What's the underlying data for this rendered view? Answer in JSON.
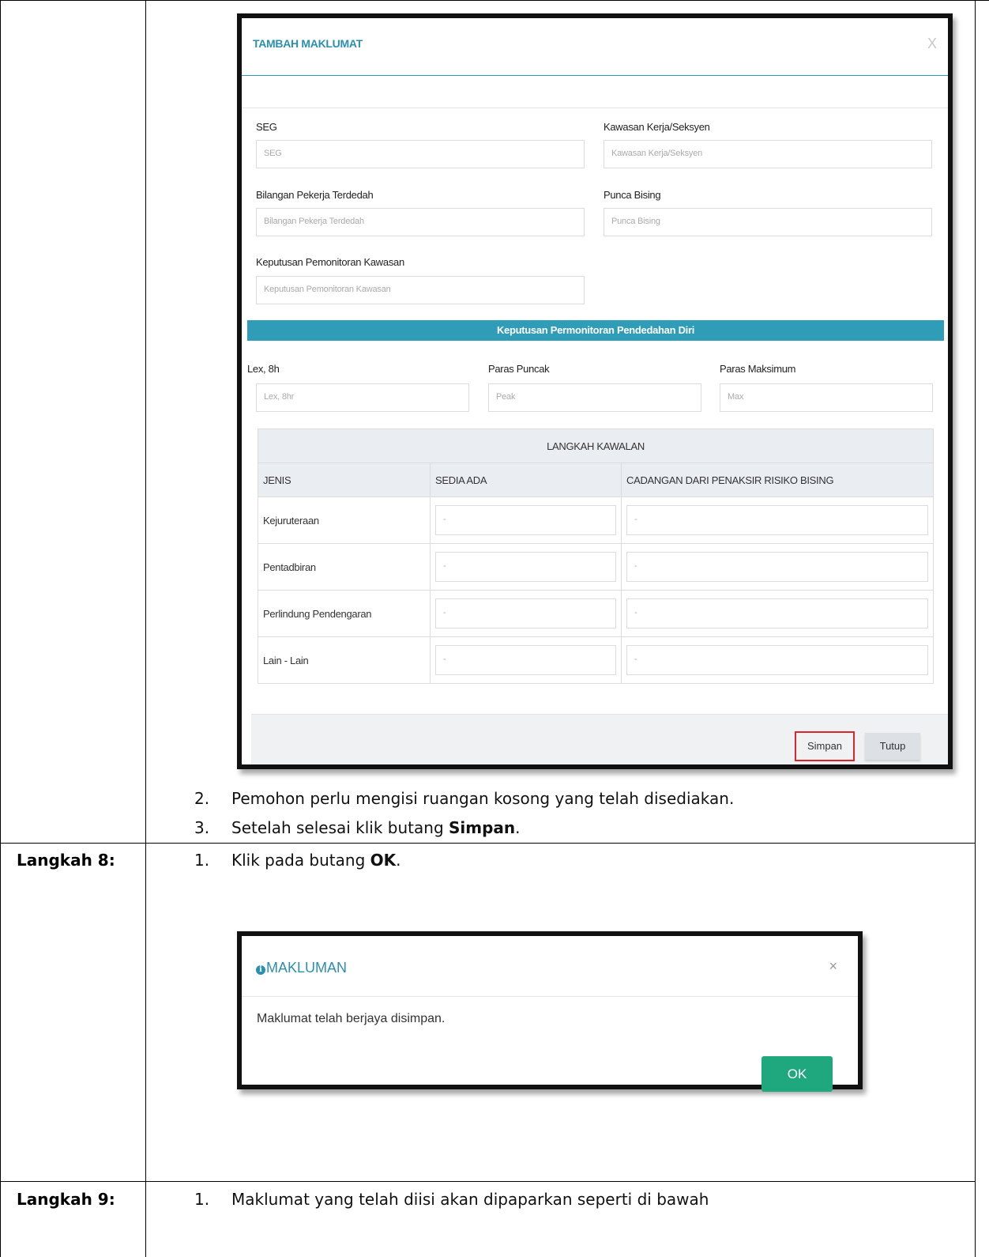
{
  "modal1": {
    "title": "TAMBAH MAKLUMAT",
    "close": "X",
    "fields": {
      "seg": {
        "label": "SEG",
        "placeholder": "SEG"
      },
      "kawasan": {
        "label": "Kawasan Kerja/Seksyen",
        "placeholder": "Kawasan Kerja/Seksyen"
      },
      "bilangan": {
        "label": "Bilangan Pekerja Terdedah",
        "placeholder": "Bilangan Pekerja Terdedah"
      },
      "punca": {
        "label": "Punca Bising",
        "placeholder": "Punca Bising"
      },
      "keputusan": {
        "label": "Keputusan Pemonitoran Kawasan",
        "placeholder": "Keputusan Pemonitoran Kawasan"
      }
    },
    "section_band": "Keputusan Permonitoran Pendedahan Diri",
    "exposure": {
      "lex": {
        "label": "Lex, 8h",
        "placeholder": "Lex, 8hr"
      },
      "puncak": {
        "label": "Paras Puncak",
        "placeholder": "Peak"
      },
      "maksimum": {
        "label": "Paras Maksimum",
        "placeholder": "Max"
      }
    },
    "table": {
      "title": "LANGKAH KAWALAN",
      "columns": [
        "JENIS",
        "SEDIA ADA",
        "CADANGAN DARI PENAKSIR RISIKO BISING"
      ],
      "rows": [
        "Kejuruteraan",
        "Pentadbiran",
        "Perlindung Pendengaran",
        "Lain - Lain"
      ],
      "cell_placeholder": "-"
    },
    "buttons": {
      "save": "Simpan",
      "close": "Tutup"
    }
  },
  "doc": {
    "step7_items": [
      {
        "num": "2.",
        "text": "Pemohon perlu mengisi ruangan kosong yang telah disediakan."
      },
      {
        "num": "3.",
        "pre": "Setelah selesai klik butang ",
        "bold": "Simpan",
        "post": "."
      }
    ],
    "step8": {
      "label": "Langkah 8:",
      "num": "1.",
      "pre": "Klik pada butang ",
      "bold": "OK",
      "post": "."
    },
    "step9": {
      "label": "Langkah 9:",
      "num": "1.",
      "text": "Maklumat yang telah diisi akan dipaparkan seperti di bawah"
    }
  },
  "modal2": {
    "title": "MAKLUMAN",
    "info_glyph": "i",
    "close": "×",
    "message": "Maklumat telah berjaya disimpan.",
    "ok": "OK"
  }
}
